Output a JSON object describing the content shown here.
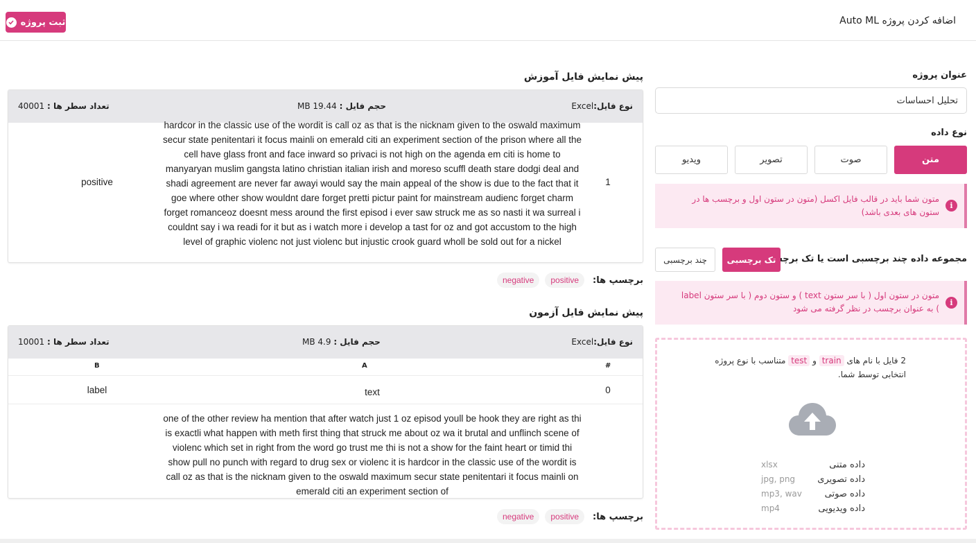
{
  "header": {
    "title": "اضافه کردن پروژه Auto ML",
    "submit_label": "ثبت پروژه"
  },
  "form": {
    "project_title_label": "عنوان پروژه",
    "project_title_value": "تحلیل احساسات",
    "data_type_label": "نوع داده",
    "data_types": [
      "متن",
      "صوت",
      "تصویر",
      "ویدیو"
    ],
    "data_type_selected": "متن",
    "info_1": "متون شما باید در قالب فایل اکسل (متون در ستون اول و برچسب ها در ستون های بعدی باشد)",
    "label_question": "مجموعه داده چند برچسبی است یا تک برچسبی؟",
    "single_label": "تک برچسبی",
    "multi_label": "چند برچسبی",
    "info_2": "متون در ستون اول ( با سر ستون text ) و ستون دوم ( با سر ستون label ) به عنوان برچسب در نظر گرفته می شود"
  },
  "upload": {
    "text_prefix": "2 فایل با نام های",
    "file_train": "train",
    "conj": "و",
    "file_test": "test",
    "text_suffix": "متناسب با نوع پروژه انتخابی توسط شما.",
    "types": [
      {
        "name": "داده متنی",
        "ext": "xlsx"
      },
      {
        "name": "داده تصویری",
        "ext": "jpg, png"
      },
      {
        "name": "داده صوتی",
        "ext": "mp3, wav"
      },
      {
        "name": "داده ویدیویی",
        "ext": "mp4"
      }
    ]
  },
  "train_preview": {
    "title": "پیش نمایش فایل آموزش",
    "file_type_label": "نوع فایل:",
    "file_type": "Excel",
    "file_size_label": "حجم فایل :",
    "file_size": "MB 19.44",
    "rows_label": "تعداد سطر ها :",
    "rows": "40001",
    "row_num": "1",
    "row_label": "positive",
    "row_text": "hardcor in the classic use of the wordit is call oz as that is the nicknam given to the oswald maximum secur state penitentari it focus mainli on emerald citi an experiment section of the prison where all the cell have glass front and face inward so privaci is not high on the agenda em citi is home to manyaryan muslim gangsta latino christian italian irish and moreso scuffl death stare dodgi deal and shadi agreement are never far awayi would say the main appeal of the show is due to the fact that it goe where other show wouldnt dare forget pretti pictur paint for mainstream audienc forget charm forget romanceoz doesnt mess around the first episod i ever saw struck me as so nasti it wa surreal i couldnt say i wa readi for it but as i watch more i develop a tast for oz and got accustom to the high level of graphic violenc not just violenc but injustic crook guard wholl be sold out for a nickel",
    "tags_label": "برچسپ ها:",
    "tags": [
      "positive",
      "negative"
    ]
  },
  "test_preview": {
    "title": "پیش نمایش فایل آزمون",
    "file_type_label": "نوع فایل:",
    "file_type": "Excel",
    "file_size_label": "حجم فایل :",
    "file_size": "MB 4.9",
    "rows_label": "تعداد سطر ها :",
    "rows": "10001",
    "columns": [
      "#",
      "A",
      "B"
    ],
    "header_row": [
      "0",
      "text",
      "label"
    ],
    "row_text": "one of the other review ha mention that after watch just 1 oz episod youll be hook they are right as thi is exactli what happen with meth first thing that struck me about oz wa it brutal and unflinch scene of violenc which set in right from the word go trust me thi is not a show for the faint heart or timid thi show pull no punch with regard to drug sex or violenc it is hardcor in the classic use of the wordit is call oz as that is the nicknam given to the oswald maximum secur state penitentari it focus mainli on emerald citi an experiment section of",
    "tags_label": "برچسپ ها:",
    "tags": [
      "positive",
      "negative"
    ]
  },
  "colors": {
    "accent": "#d63a7c",
    "info_bg": "#fce9f2",
    "upload_border": "#f6c7dc"
  }
}
